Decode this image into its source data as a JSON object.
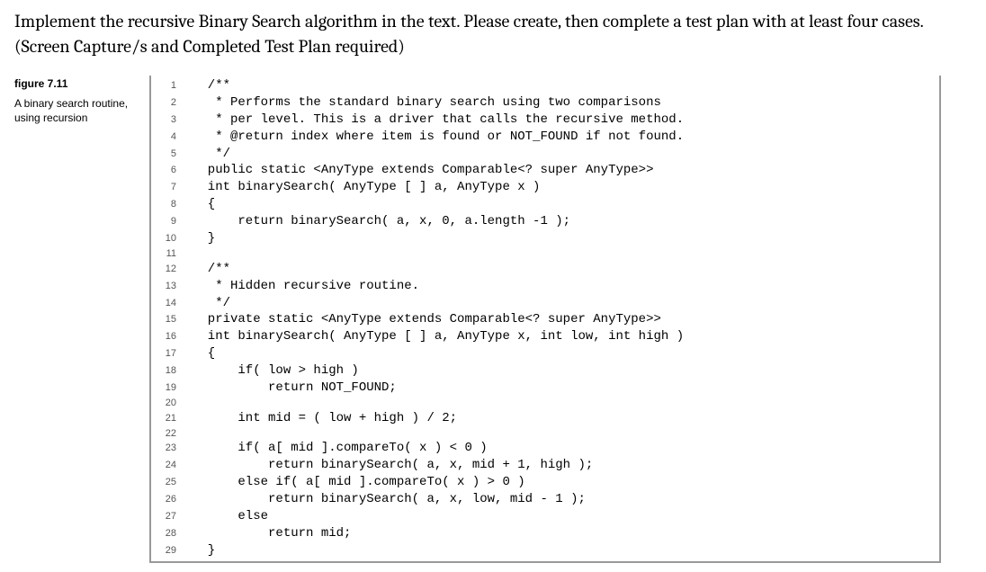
{
  "instruction": "Implement the recursive Binary Search algorithm in the text.  Please create, then complete a test plan with at least four cases.  (Screen Capture/s and Completed Test Plan required)",
  "figure": {
    "title": "figure 7.11",
    "description": "A binary search routine, using recursion"
  },
  "code_lines": [
    {
      "n": 1,
      "t": "  /**"
    },
    {
      "n": 2,
      "t": "   * Performs the standard binary search using two comparisons"
    },
    {
      "n": 3,
      "t": "   * per level. This is a driver that calls the recursive method."
    },
    {
      "n": 4,
      "t": "   * @return index where item is found or NOT_FOUND if not found."
    },
    {
      "n": 5,
      "t": "   */"
    },
    {
      "n": 6,
      "t": "  public static <AnyType extends Comparable<? super AnyType>>"
    },
    {
      "n": 7,
      "t": "  int binarySearch( AnyType [ ] a, AnyType x )"
    },
    {
      "n": 8,
      "t": "  {"
    },
    {
      "n": 9,
      "t": "      return binarySearch( a, x, 0, a.length -1 );"
    },
    {
      "n": 10,
      "t": "  }"
    },
    {
      "n": 11,
      "t": ""
    },
    {
      "n": 12,
      "t": "  /**"
    },
    {
      "n": 13,
      "t": "   * Hidden recursive routine."
    },
    {
      "n": 14,
      "t": "   */"
    },
    {
      "n": 15,
      "t": "  private static <AnyType extends Comparable<? super AnyType>>"
    },
    {
      "n": 16,
      "t": "  int binarySearch( AnyType [ ] a, AnyType x, int low, int high )"
    },
    {
      "n": 17,
      "t": "  {"
    },
    {
      "n": 18,
      "t": "      if( low > high )"
    },
    {
      "n": 19,
      "t": "          return NOT_FOUND;"
    },
    {
      "n": 20,
      "t": ""
    },
    {
      "n": 21,
      "t": "      int mid = ( low + high ) / 2;"
    },
    {
      "n": 22,
      "t": ""
    },
    {
      "n": 23,
      "t": "      if( a[ mid ].compareTo( x ) < 0 )"
    },
    {
      "n": 24,
      "t": "          return binarySearch( a, x, mid + 1, high );"
    },
    {
      "n": 25,
      "t": "      else if( a[ mid ].compareTo( x ) > 0 )"
    },
    {
      "n": 26,
      "t": "          return binarySearch( a, x, low, mid - 1 );"
    },
    {
      "n": 27,
      "t": "      else"
    },
    {
      "n": 28,
      "t": "          return mid;"
    },
    {
      "n": 29,
      "t": "  }"
    }
  ]
}
